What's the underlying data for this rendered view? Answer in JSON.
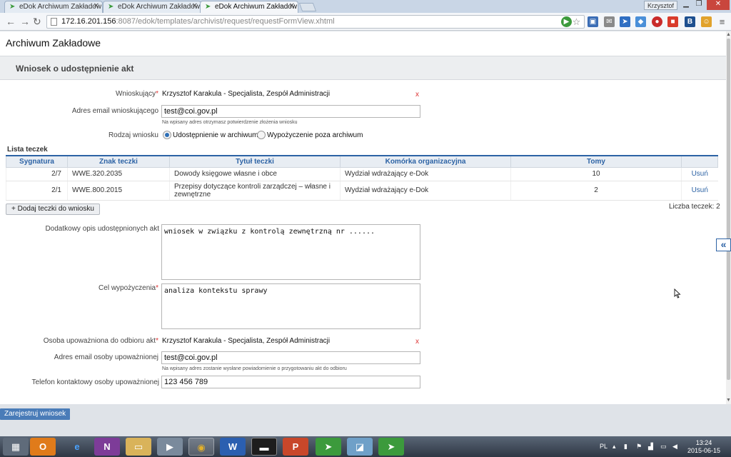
{
  "browser": {
    "tabs": [
      {
        "title": "eDok Archiwum Zakładow",
        "active": false
      },
      {
        "title": "eDok Archiwum Zakładow",
        "active": false
      },
      {
        "title": "eDok Archiwum Zakładow",
        "active": true
      }
    ],
    "user": "Krzysztof",
    "url_host": "172.16.201.156",
    "url_rest": ":8087/edok/templates/archivist/request/requestFormView.xhtml"
  },
  "app": {
    "title": "Archiwum Zakładowe",
    "section_title": "Wniosek o udostępnienie akt"
  },
  "form": {
    "requester_label": "Wnioskujący",
    "requester_value": "Krzysztof Karakula - Specjalista, Zespół Administracji",
    "requester_email_label": "Adres email wnioskującego",
    "requester_email_value": "test@coi.gov.pl",
    "requester_email_hint": "Na wpisany adres otrzymasz potwierdzenie złożenia wniosku",
    "request_type_label": "Rodzaj wniosku",
    "request_type_options": [
      "Udostępnienie w archiwum",
      "Wypożyczenie poza archiwum"
    ],
    "request_type_selected": "Udostępnienie w archiwum",
    "extra_desc_label": "Dodatkowy opis udostępnionych akt",
    "extra_desc_value": "wniosek w związku z kontrolą zewnętrzną nr ......",
    "purpose_label": "Cel wypożyczenia",
    "purpose_value": "analiza kontekstu sprawy",
    "authorized_label": "Osoba upoważniona do odbioru akt",
    "authorized_value": "Krzysztof Karakula - Specjalista, Zespół Administracji",
    "authorized_email_label": "Adres email osoby upoważnionej",
    "authorized_email_value": "test@coi.gov.pl",
    "authorized_email_hint": "Na wpisany adres zostanie wysłane powiadomienie o przygotowaniu akt do odbioru",
    "phone_label": "Telefon kontaktowy osoby upoważnionej",
    "phone_value": "123 456 789",
    "required_mark": "*",
    "clear_mark": "x"
  },
  "folders": {
    "title": "Lista teczek",
    "columns": [
      "Sygnatura",
      "Znak teczki",
      "Tytuł teczki",
      "Komórka organizacyjna",
      "Tomy",
      ""
    ],
    "rows": [
      {
        "sygnatura": "2/7",
        "znak": "WWE.320.2035",
        "tytul": "Dowody księgowe własne i obce",
        "komorka": "Wydział wdrażający e-Dok",
        "tomy": "10",
        "action": "Usuń"
      },
      {
        "sygnatura": "2/1",
        "znak": "WWE.800.2015",
        "tytul": "Przepisy dotyczące kontroli zarządczej – własne i zewnętrzne",
        "komorka": "Wydział wdrażający e-Dok",
        "tomy": "2",
        "action": "Usuń"
      }
    ],
    "add_button": "Dodaj teczki do wniosku",
    "add_button_icon": "+",
    "count_label": "Liczba teczek: 2"
  },
  "actions": {
    "register": "Zarejestruj wniosek",
    "collapse_icon": "«"
  },
  "taskbar": {
    "language": "PL",
    "time": "13:24",
    "date": "2015-06-15"
  }
}
